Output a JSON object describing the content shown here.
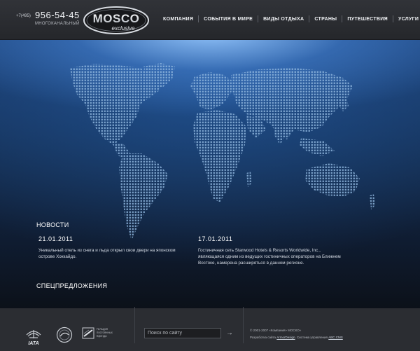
{
  "header": {
    "phone_prefix": "+7(495)",
    "phone_number": "956-54-45",
    "phone_caption": "МНОГОКАНАЛЬНЫЙ",
    "logo_main": "MOSCO",
    "logo_sub": "exclusive",
    "nav": [
      "КОМПАНИЯ",
      "СОБЫТИЯ В МИРЕ",
      "ВИДЫ ОТДЫХА",
      "СТРАНЫ",
      "ПУТЕШЕСТВИЯ",
      "УСЛУГИ"
    ]
  },
  "news": {
    "title": "НОВОСТИ",
    "items": [
      {
        "date": "21.01.2011",
        "text": "Уникальный отель из снега и льда открыл свои двери на японском острове Хоккайдо."
      },
      {
        "date": "17.01.2011",
        "text": "Гостиничная сеть Starwood Hotels & Resorts Worldwide, Inc., являющаяся одним из ведущих гостиничных операторов на Ближнем Востоке, намерена расширяться в данном регионе."
      }
    ]
  },
  "offers": {
    "title": "СПЕЦПРЕДЛОЖЕНИЯ"
  },
  "footer": {
    "iata_label": "IATA",
    "badge_caption": "Гильдия\nпостоянных\nБренда",
    "search_placeholder": "Поиск по сайту",
    "search_arrow": "→",
    "copyright_line1": "© 2001-2007 «Компания» МОСКО»",
    "copyright_prefix": "Разработка сайта",
    "copyright_dev": "ArmorDesign",
    "copyright_middle": ". Система управления",
    "copyright_cms": "ABC.CMS"
  },
  "colors": {
    "accent": "#4f8fd8",
    "background": "#2b2d32",
    "dots": "#8fb6de"
  },
  "icons": [
    "mosco-logo",
    "world-map-dots",
    "iata-logo",
    "round-badge-icon",
    "guild-badge-icon",
    "arrow-right-icon"
  ]
}
